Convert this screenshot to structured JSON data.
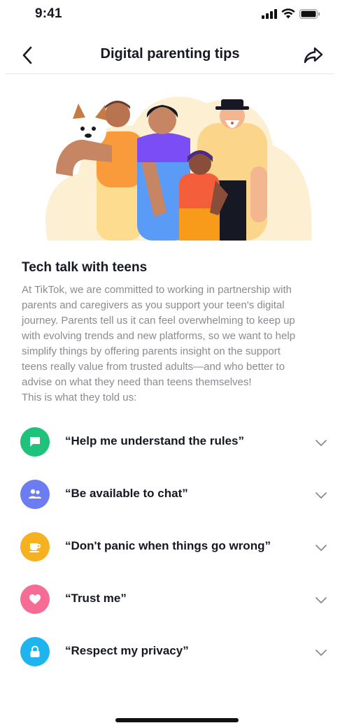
{
  "status_bar": {
    "time": "9:41"
  },
  "header": {
    "title": "Digital parenting tips",
    "back_icon": "chevron-left-icon",
    "share_icon": "share-arrow-icon"
  },
  "article": {
    "title": "Tech talk with teens",
    "body_lines": [
      "At TikTok, we are committed to working in partnership with",
      "parents and caregivers as you support your teen's digital",
      "journey. Parents tell us it can feel overwhelming to keep up",
      "with evolving trends and new platforms, so we want to help",
      "simplify things by offering parents insight on the support",
      "teens really value from trusted adults—and who better to",
      "advise on what they need than teens themselves!",
      "This is what they told us:"
    ]
  },
  "tips": [
    {
      "label": "“Help me understand the rules”",
      "icon": "chat-bubble-icon",
      "color": "#1ec27a"
    },
    {
      "label": "“Be available to chat”",
      "icon": "people-icon",
      "color": "#6c7cf2"
    },
    {
      "label": "“Don't panic when things go wrong”",
      "icon": "coffee-cup-icon",
      "color": "#f5b120"
    },
    {
      "label": "“Trust me”",
      "icon": "heart-icon",
      "color": "#f76c95"
    },
    {
      "label": "“Respect my privacy”",
      "icon": "lock-icon",
      "color": "#1eb5ee"
    }
  ],
  "colors": {
    "text_primary": "#161823",
    "text_secondary": "#8a8b91",
    "divider": "#e6e6e8"
  }
}
